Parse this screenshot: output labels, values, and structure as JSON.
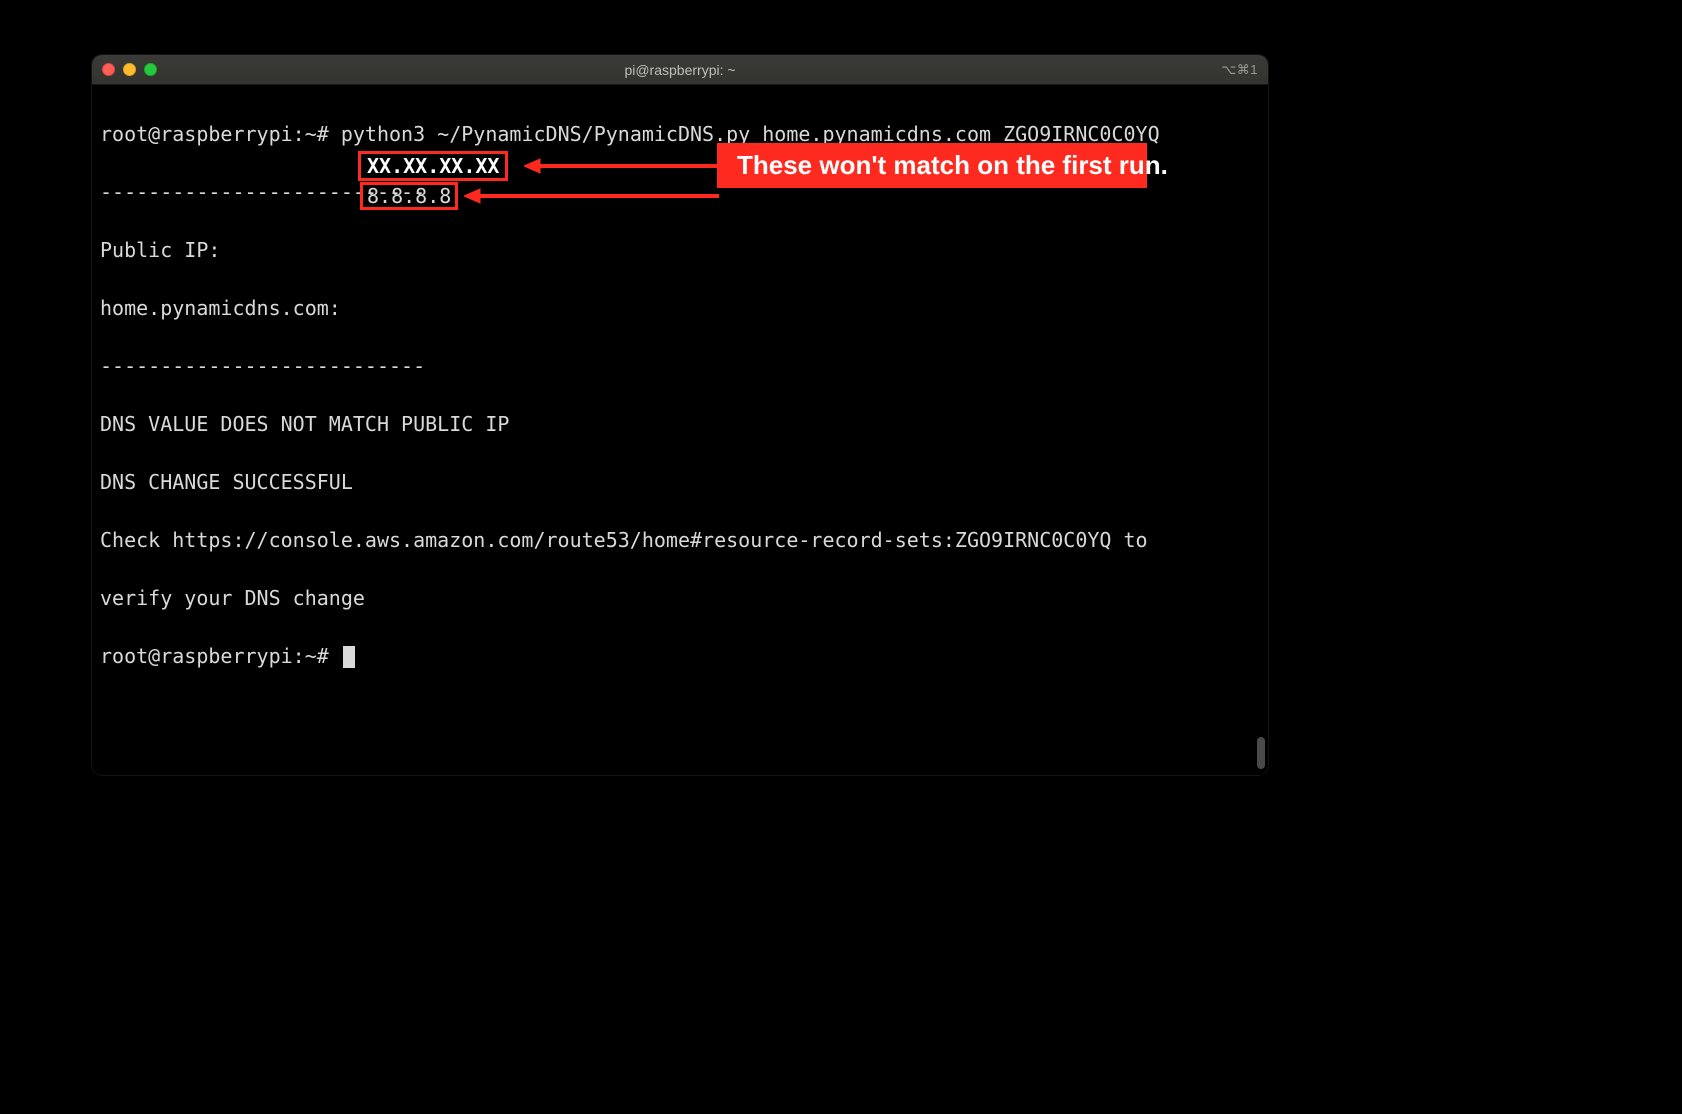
{
  "window": {
    "title": "pi@raspberrypi: ~",
    "shortcut_hint": "⌥⌘1"
  },
  "terminal": {
    "prompt1": "root@raspberrypi:~# ",
    "command": "python3 ~/PynamicDNS/PynamicDNS.py home.pynamicdns.com ZGO9IRNC0C0YQ",
    "divider": "---------------------------",
    "public_ip_label": "Public IP:",
    "public_ip_value": "XX.XX.XX.XX",
    "domain_label": "home.pynamicdns.com:",
    "domain_value": "8.8.8.8",
    "mismatch_line": "DNS VALUE DOES NOT MATCH PUBLIC IP",
    "success_line": "DNS CHANGE SUCCESSFUL",
    "verify_line1": "Check https://console.aws.amazon.com/route53/home#resource-record-sets:ZGO9IRNC0C0YQ to",
    "verify_line2": "verify your DNS change",
    "prompt2": "root@raspberrypi:~# "
  },
  "annotation": {
    "callout_text": "These won't match on the first run."
  }
}
